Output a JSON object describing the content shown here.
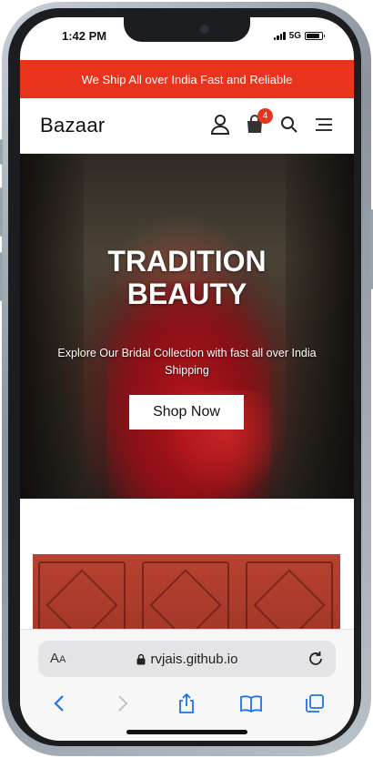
{
  "status_bar": {
    "time": "1:42 PM",
    "network": "5G",
    "battery_level": 0.9
  },
  "announcement": {
    "text": "We Ship All over India Fast and Reliable",
    "background_color": "#e8341c"
  },
  "header": {
    "brand": "Bazaar",
    "cart_count": "4",
    "icons": [
      "user-icon",
      "shopping-bag-icon",
      "search-icon",
      "menu-icon"
    ]
  },
  "hero": {
    "title_line1": "TRADITION",
    "title_line2": "BEAUTY",
    "subtitle": "Explore Our Bridal Collection with fast all over India Shipping",
    "cta_label": "Shop Now"
  },
  "browser": {
    "text_size_label": "AA",
    "url": "rvjais.github.io",
    "toolbar_icons": [
      "back-icon",
      "forward-icon",
      "share-icon",
      "bookmarks-icon",
      "tabs-icon"
    ]
  },
  "colors": {
    "accent": "#e8341c",
    "browser_blue": "#1e73e8"
  }
}
